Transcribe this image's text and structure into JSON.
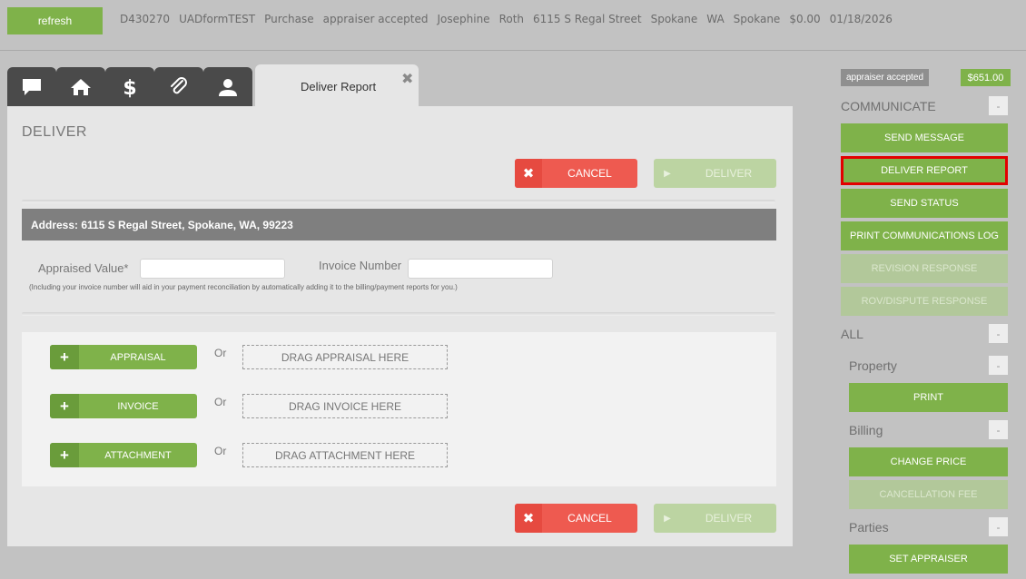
{
  "topbar": {
    "refresh_label": "refresh",
    "order_fields": [
      "D430270",
      "UADformTEST",
      "Purchase",
      "appraiser accepted",
      "Josephine",
      "Roth",
      "6115 S Regal Street",
      "Spokane",
      "WA",
      "Spokane",
      "$0.00",
      "01/18/2026"
    ]
  },
  "tabs": {
    "icons": [
      "chat-icon",
      "home-icon",
      "dollar-icon",
      "paperclip-icon",
      "user-icon"
    ],
    "active_label": "Deliver Report",
    "close_glyph": "✖"
  },
  "deliver": {
    "title": "DELIVER",
    "cancel_label": "CANCEL",
    "deliver_label": "DELIVER",
    "address": "Address: 6115 S Regal Street, Spokane, WA, 99223",
    "appraised_value_label": "Appraised Value*",
    "appraised_value": "",
    "invoice_number_label": "Invoice Number",
    "invoice_number": "",
    "hint": "(Including your invoice number will aid in your payment reconciliation by automatically adding it to the billing/payment reports for you.)",
    "or_label": "Or",
    "uploads": [
      {
        "button": "APPRAISAL",
        "drop": "DRAG APPRAISAL HERE"
      },
      {
        "button": "INVOICE",
        "drop": "DRAG INVOICE HERE"
      },
      {
        "button": "ATTACHMENT",
        "drop": "DRAG ATTACHMENT HERE"
      }
    ]
  },
  "sidebar": {
    "status": "appraiser accepted",
    "price": "$651.00",
    "communicate_label": "COMMUNICATE",
    "communicate_buttons": [
      "SEND MESSAGE",
      "DELIVER REPORT",
      "SEND STATUS",
      "PRINT COMMUNICATIONS LOG",
      "REVISION RESPONSE",
      "ROV/DISPUTE RESPONSE"
    ],
    "all_label": "ALL",
    "property_label": "Property",
    "print_label": "PRINT",
    "billing_label": "Billing",
    "change_price_label": "CHANGE PRICE",
    "cancellation_fee_label": "CANCELLATION FEE",
    "parties_label": "Parties",
    "set_appraiser_label": "SET APPRAISER",
    "collapse_glyph": "-"
  },
  "colors": {
    "green": "#7fb24a",
    "red": "#ee5a50",
    "disabled_green": "#b2c89a",
    "highlight": "#e30000"
  }
}
